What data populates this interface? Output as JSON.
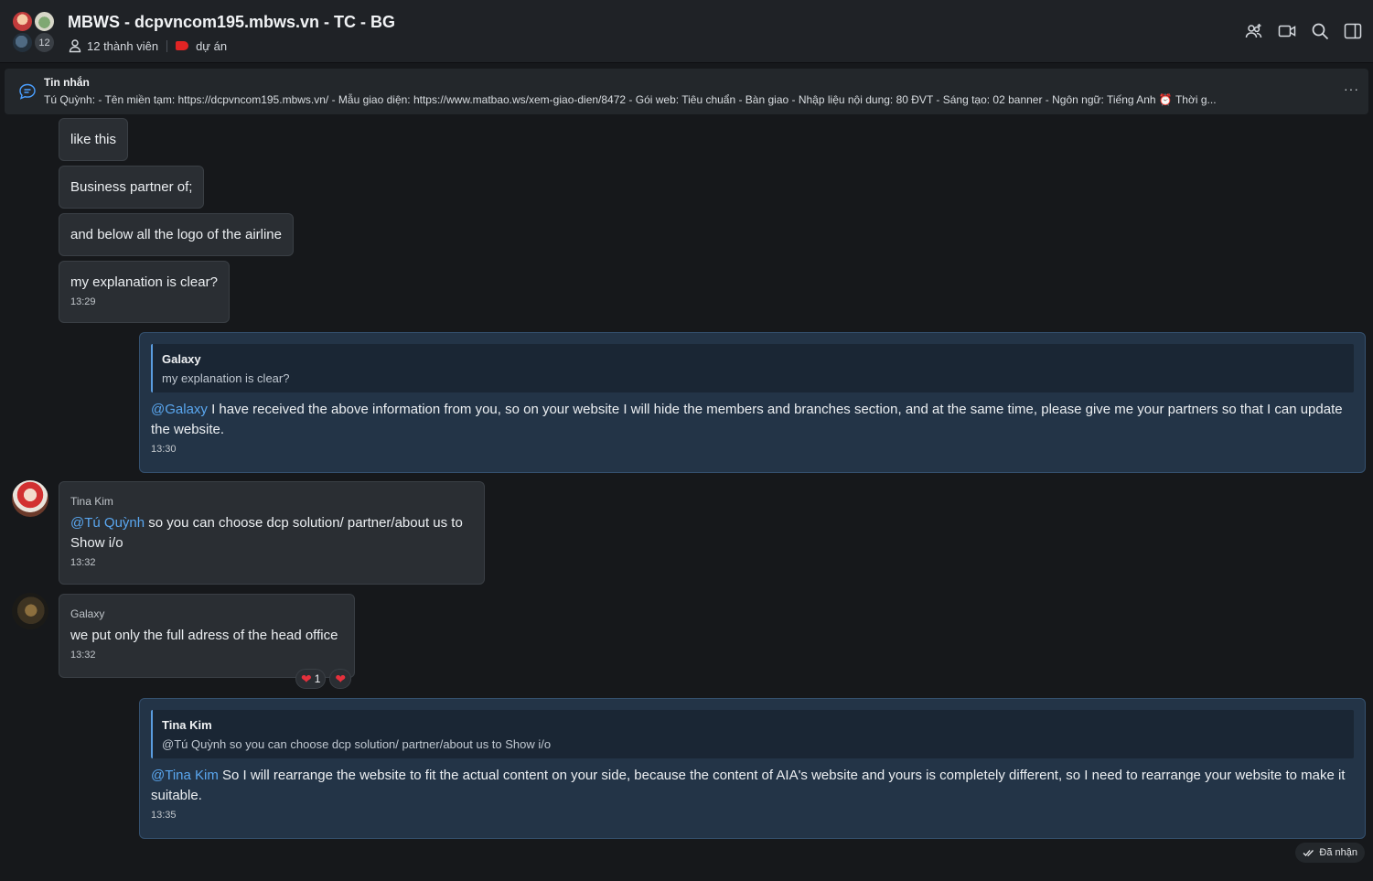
{
  "header": {
    "title": "MBWS - dcpvncom195.mbws.vn - TC - BG",
    "member_count_badge": "12",
    "members_label": "12 thành viên",
    "tag_label": "dự án",
    "tag_color": "#e02424",
    "actions": [
      "add-member-icon",
      "video-call-icon",
      "search-icon",
      "side-panel-icon"
    ]
  },
  "pinned": {
    "title": "Tin nhắn",
    "text": "Tú Quỳnh: - Tên miền tạm: https://dcpvncom195.mbws.vn/ - Mẫu giao diện: https://www.matbao.ws/xem-giao-dien/8472 - Gói web: Tiêu chuẩn - Bàn giao - Nhập liệu nội dung: 80 ĐVT - Sáng tạo: 02 banner - Ngôn ngữ: Tiếng Anh ⏰ Thời g...",
    "more": "···"
  },
  "messages": {
    "m1": {
      "text": "like this"
    },
    "m2": {
      "text": "Business partner of;"
    },
    "m3": {
      "text": "and below all the logo of the airline"
    },
    "m4": {
      "text": "my explanation is clear?",
      "time": "13:29"
    },
    "m5": {
      "quote_author": "Galaxy",
      "quote_text": "my explanation is clear?",
      "mention": "@Galaxy",
      "text": " I have received the above information from you, so on your website I will hide the members and branches section, and at the same time, please give me your partners so that I can update the website.",
      "time": "13:30"
    },
    "m6": {
      "sender": "Tina Kim",
      "mention": "@Tú Quỳnh",
      "text": " so you can choose dcp solution/ partner/about us to Show i/o",
      "time": "13:32"
    },
    "m7": {
      "sender": "Galaxy",
      "text": "we put only the full adress of the head office",
      "time": "13:32",
      "reaction_count": "1",
      "reaction_emoji": "❤"
    },
    "m8": {
      "quote_author": "Tina Kim",
      "quote_text": "@Tú Quỳnh so you can choose dcp solution/ partner/about us to Show i/o",
      "mention": "@Tina Kim",
      "text": " So I will rearrange the website to fit the actual content on your side, because the content of AIA's website and yours is completely different, so I need to rearrange your website to make it suitable.",
      "time": "13:35"
    }
  },
  "status": {
    "label": "Đã nhận"
  },
  "colors": {
    "background": "#16181b",
    "bubble_other": "#2a2e33",
    "bubble_mine": "#233447",
    "mention": "#5aa7f0"
  }
}
